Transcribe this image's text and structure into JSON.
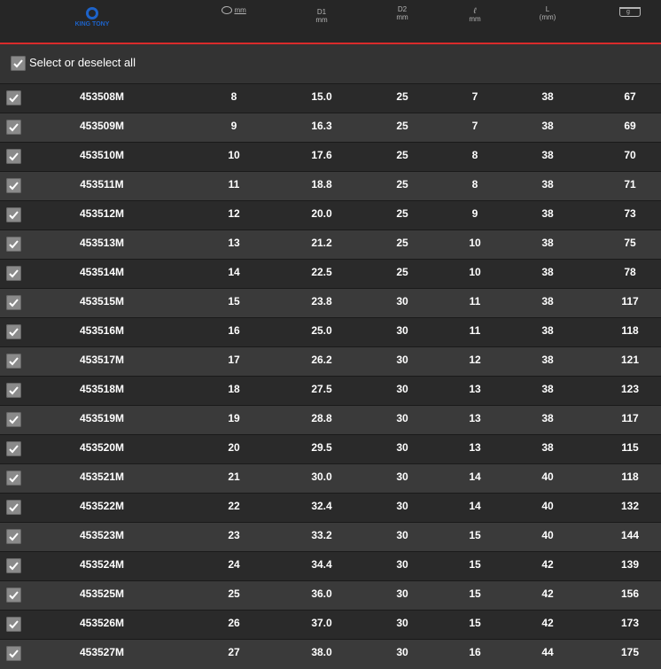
{
  "header": {
    "brand": "KING TONY",
    "col_size_unit": "mm",
    "col_d1": [
      "D1",
      "mm"
    ],
    "col_d2": [
      "D2",
      "mm"
    ],
    "col_l_small": [
      "ℓ",
      "mm"
    ],
    "col_l_big": [
      "L",
      "(mm)"
    ],
    "col_weight": "g"
  },
  "select_all_label": "Select or deselect all",
  "rows": [
    {
      "code": "453508M",
      "size": "8",
      "d1": "15.0",
      "d2": "25",
      "l": "7",
      "L": "38",
      "w": "67"
    },
    {
      "code": "453509M",
      "size": "9",
      "d1": "16.3",
      "d2": "25",
      "l": "7",
      "L": "38",
      "w": "69"
    },
    {
      "code": "453510M",
      "size": "10",
      "d1": "17.6",
      "d2": "25",
      "l": "8",
      "L": "38",
      "w": "70"
    },
    {
      "code": "453511M",
      "size": "11",
      "d1": "18.8",
      "d2": "25",
      "l": "8",
      "L": "38",
      "w": "71"
    },
    {
      "code": "453512M",
      "size": "12",
      "d1": "20.0",
      "d2": "25",
      "l": "9",
      "L": "38",
      "w": "73"
    },
    {
      "code": "453513M",
      "size": "13",
      "d1": "21.2",
      "d2": "25",
      "l": "10",
      "L": "38",
      "w": "75"
    },
    {
      "code": "453514M",
      "size": "14",
      "d1": "22.5",
      "d2": "25",
      "l": "10",
      "L": "38",
      "w": "78"
    },
    {
      "code": "453515M",
      "size": "15",
      "d1": "23.8",
      "d2": "30",
      "l": "11",
      "L": "38",
      "w": "117"
    },
    {
      "code": "453516M",
      "size": "16",
      "d1": "25.0",
      "d2": "30",
      "l": "11",
      "L": "38",
      "w": "118"
    },
    {
      "code": "453517M",
      "size": "17",
      "d1": "26.2",
      "d2": "30",
      "l": "12",
      "L": "38",
      "w": "121"
    },
    {
      "code": "453518M",
      "size": "18",
      "d1": "27.5",
      "d2": "30",
      "l": "13",
      "L": "38",
      "w": "123"
    },
    {
      "code": "453519M",
      "size": "19",
      "d1": "28.8",
      "d2": "30",
      "l": "13",
      "L": "38",
      "w": "117"
    },
    {
      "code": "453520M",
      "size": "20",
      "d1": "29.5",
      "d2": "30",
      "l": "13",
      "L": "38",
      "w": "115"
    },
    {
      "code": "453521M",
      "size": "21",
      "d1": "30.0",
      "d2": "30",
      "l": "14",
      "L": "40",
      "w": "118"
    },
    {
      "code": "453522M",
      "size": "22",
      "d1": "32.4",
      "d2": "30",
      "l": "14",
      "L": "40",
      "w": "132"
    },
    {
      "code": "453523M",
      "size": "23",
      "d1": "33.2",
      "d2": "30",
      "l": "15",
      "L": "40",
      "w": "144"
    },
    {
      "code": "453524M",
      "size": "24",
      "d1": "34.4",
      "d2": "30",
      "l": "15",
      "L": "42",
      "w": "139"
    },
    {
      "code": "453525M",
      "size": "25",
      "d1": "36.0",
      "d2": "30",
      "l": "15",
      "L": "42",
      "w": "156"
    },
    {
      "code": "453526M",
      "size": "26",
      "d1": "37.0",
      "d2": "30",
      "l": "15",
      "L": "42",
      "w": "173"
    },
    {
      "code": "453527M",
      "size": "27",
      "d1": "38.0",
      "d2": "30",
      "l": "16",
      "L": "44",
      "w": "175"
    }
  ]
}
